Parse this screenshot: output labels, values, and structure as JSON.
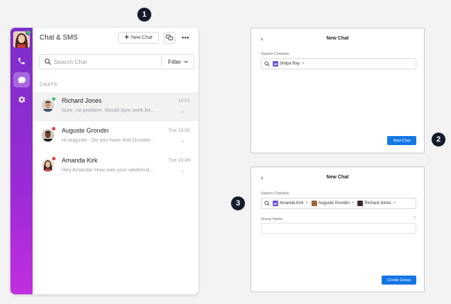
{
  "steps": [
    "1",
    "2",
    "3"
  ],
  "app": {
    "title": "Chat & SMS",
    "new_chat_label": "New Chat",
    "more_label": "•••",
    "search_placeholder": "Search Chat",
    "filter_label": "Filter",
    "section_label": "CHATS",
    "chats": [
      {
        "name": "Richard Jones",
        "preview": "Sure, no problem. Would 2pm work for...",
        "time": "16:01",
        "status_color": "#37c45f"
      },
      {
        "name": "Auguste Grondin",
        "preview": "Hi Auguste - Do you have that October...",
        "time": "Tue 16:50",
        "status_color": "#e0424a"
      },
      {
        "name": "Amanda Kirk",
        "preview": "Hey Amanda! How was your weekend...",
        "time": "Tue 16:49",
        "status_color": "#e0424a"
      }
    ]
  },
  "dialog_single": {
    "back": "‹",
    "title": "New Chat",
    "search_label": "Search Contacts",
    "tokens": [
      {
        "initials": "SR",
        "name": "Shilpa Ray",
        "color": "#6a55d6"
      }
    ],
    "button_label": "Start Chat"
  },
  "dialog_group": {
    "back": "‹",
    "title": "New Chat",
    "search_label": "Search Contacts",
    "tokens": [
      {
        "initials": "AK",
        "name": "Amanda Kirk",
        "color": "#6a55d6"
      },
      {
        "initials": "",
        "name": "Auguste Grondin",
        "color": "#a0643c"
      },
      {
        "initials": "",
        "name": "Richard Jones",
        "color": "#3b2c27"
      }
    ],
    "group_name_label": "Group Name",
    "required_mark": "*",
    "button_label": "Create Group"
  },
  "colors": {
    "rail_top": "#7b2fc9",
    "rail_bottom": "#c12fe0",
    "primary": "#1477e6"
  }
}
